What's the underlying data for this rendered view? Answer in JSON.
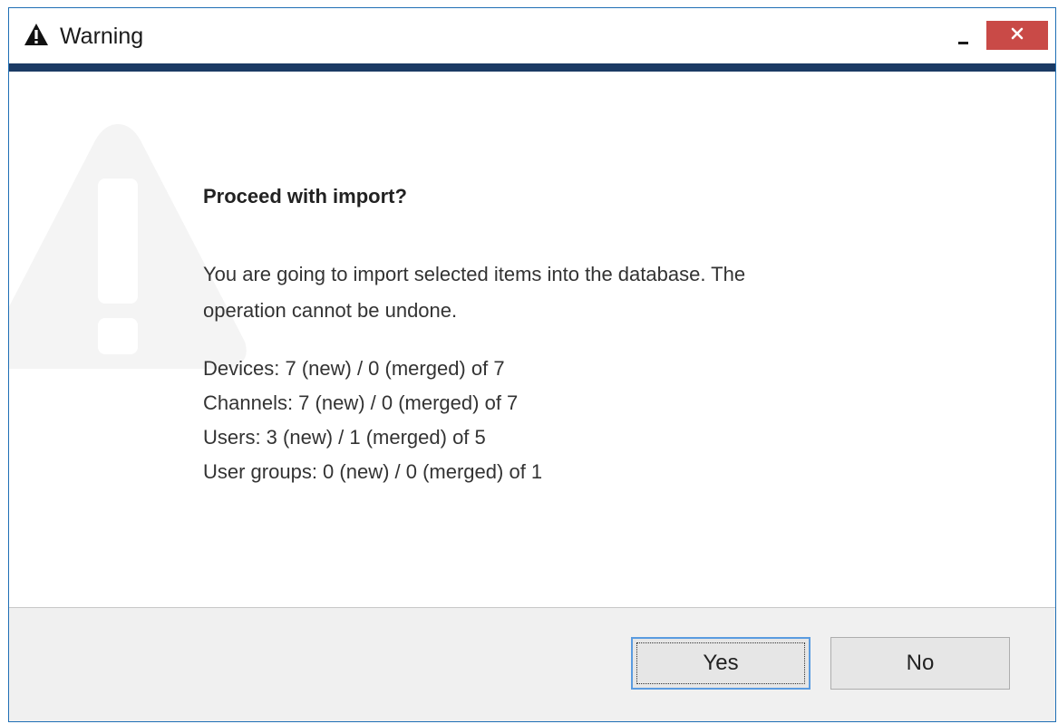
{
  "window": {
    "title": "Warning",
    "title_icon": "warning-triangle-icon",
    "minimize_icon": "minimize-icon",
    "close_icon": "close-icon",
    "accent_color": "#1b3a64",
    "close_color": "#c94a47"
  },
  "dialog": {
    "heading": "Proceed with import?",
    "message_line1": "You are going to import selected items into the database. The",
    "message_line2": "operation cannot be undone.",
    "stats": [
      "Devices: 7 (new) / 0 (merged) of 7",
      "Channels: 7 (new) / 0 (merged) of 7",
      "Users: 3 (new) / 1 (merged) of 5",
      "User groups: 0 (new) / 0 (merged) of 1"
    ],
    "watermark_icon": "warning-watermark-icon"
  },
  "buttons": {
    "yes_label": "Yes",
    "no_label": "No"
  }
}
